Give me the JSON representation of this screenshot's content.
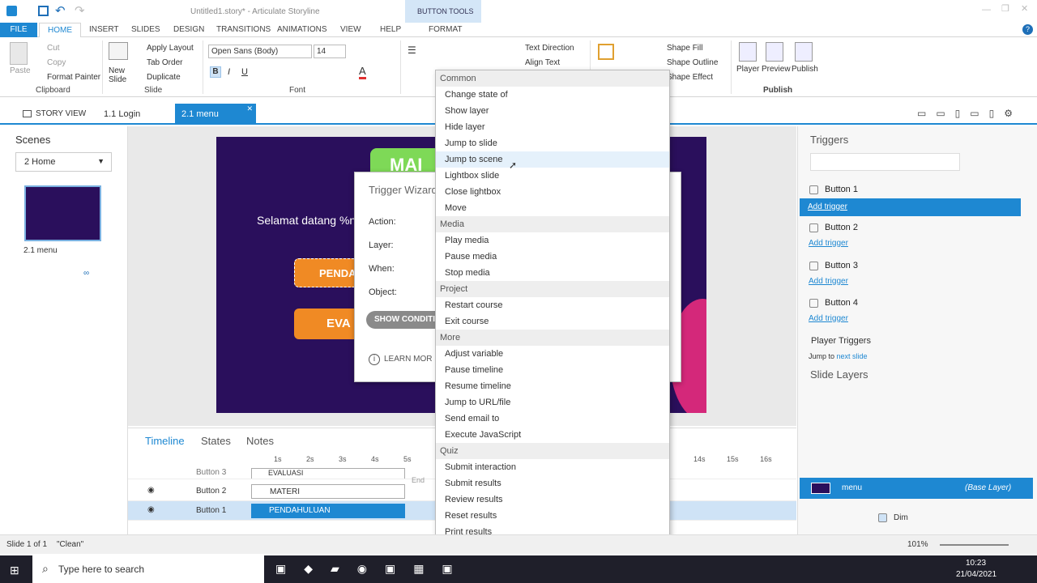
{
  "window": {
    "title": "Untitled1.story* - Articulate Storyline",
    "context_tab_group": "BUTTON TOOLS",
    "context_tab": "FORMAT"
  },
  "ribbon_tabs": [
    "FILE",
    "HOME",
    "INSERT",
    "SLIDES",
    "DESIGN",
    "TRANSITIONS",
    "ANIMATIONS",
    "VIEW",
    "HELP"
  ],
  "ribbon": {
    "paste": "Paste",
    "cut": "Cut",
    "copy": "Copy",
    "format_painter": "Format Painter",
    "clipboard": "Clipboard",
    "new_slide": "New Slide",
    "apply_layout": "Apply Layout",
    "tab_order": "Tab Order",
    "duplicate": "Duplicate",
    "slide": "Slide",
    "font_name": "Open Sans (Body)",
    "font_size": "14",
    "font": "Font",
    "text_direction": "Text Direction",
    "align_text": "Align Text",
    "shape_fill": "Shape Fill",
    "shape_outline": "Shape Outline",
    "shape_effect": "Shape Effect",
    "player": "Player",
    "preview": "Preview",
    "publish": "Publish",
    "publish_group": "Publish"
  },
  "view_tabs": {
    "story_view": "STORY VIEW",
    "tab1": "1.1 Login",
    "tab2": "2.1 menu"
  },
  "scenes": {
    "title": "Scenes",
    "selected": "2 Home",
    "thumb_label": "2.1 menu"
  },
  "slide": {
    "banner": "MAI",
    "welcome": "Selamat datang %n",
    "btn1": "PENDA",
    "btn2": "EVA"
  },
  "dialog": {
    "title": "Trigger Wizard",
    "action": "Action:",
    "layer": "Layer:",
    "when": "When:",
    "object": "Object:",
    "show_conditions": "SHOW CONDITI",
    "learn_more": "LEARN MOR"
  },
  "menu": {
    "sections": [
      {
        "header": "Common",
        "items": [
          "Change state of",
          "Show layer",
          "Hide layer",
          "Jump to slide",
          "Jump to scene",
          "Lightbox slide",
          "Close lightbox",
          "Move"
        ]
      },
      {
        "header": "Media",
        "items": [
          "Play media",
          "Pause media",
          "Stop media"
        ]
      },
      {
        "header": "Project",
        "items": [
          "Restart course",
          "Exit course"
        ]
      },
      {
        "header": "More",
        "items": [
          "Adjust variable",
          "Pause timeline",
          "Resume timeline",
          "Jump to URL/file",
          "Send email to",
          "Execute JavaScript"
        ]
      },
      {
        "header": "Quiz",
        "items": [
          "Submit interaction",
          "Submit results",
          "Review results",
          "Reset results",
          "Print results"
        ]
      }
    ],
    "highlighted": "Jump to scene"
  },
  "triggers": {
    "title": "Triggers",
    "items": [
      {
        "name": "Button 1",
        "add": "Add trigger"
      },
      {
        "name": "Button 2",
        "add": "Add trigger"
      },
      {
        "name": "Button 3",
        "add": "Add trigger"
      },
      {
        "name": "Button 4",
        "add": "Add trigger"
      }
    ],
    "player_triggers": "Player Triggers",
    "jump_to": "Jump to",
    "next_slide": "next slide"
  },
  "slide_layers": {
    "title": "Slide Layers",
    "layer_name": "menu",
    "base_layer": "(Base Layer)",
    "dim": "Dim"
  },
  "timeline": {
    "tabs": [
      "Timeline",
      "States",
      "Notes"
    ],
    "ticks": [
      "1s",
      "2s",
      "3s",
      "4s",
      "5s",
      "14s",
      "15s",
      "16s"
    ],
    "rows": [
      {
        "name": "Button 3",
        "bar": "EVALUASI"
      },
      {
        "name": "Button 2",
        "bar": "MATERI"
      },
      {
        "name": "Button 1",
        "bar": "PENDAHULUAN"
      }
    ],
    "end": "End"
  },
  "status": {
    "slide": "Slide 1 of 1",
    "clean": "\"Clean\"",
    "zoom": "101%"
  },
  "taskbar": {
    "search": "Type here to search",
    "time": "10:23",
    "date": "21/04/2021"
  },
  "colors": {
    "accent": "#1e88d2",
    "ribbon_context": "#d4e6f7",
    "slide_bg": "#2a0f5c",
    "orange": "#f08a24"
  }
}
